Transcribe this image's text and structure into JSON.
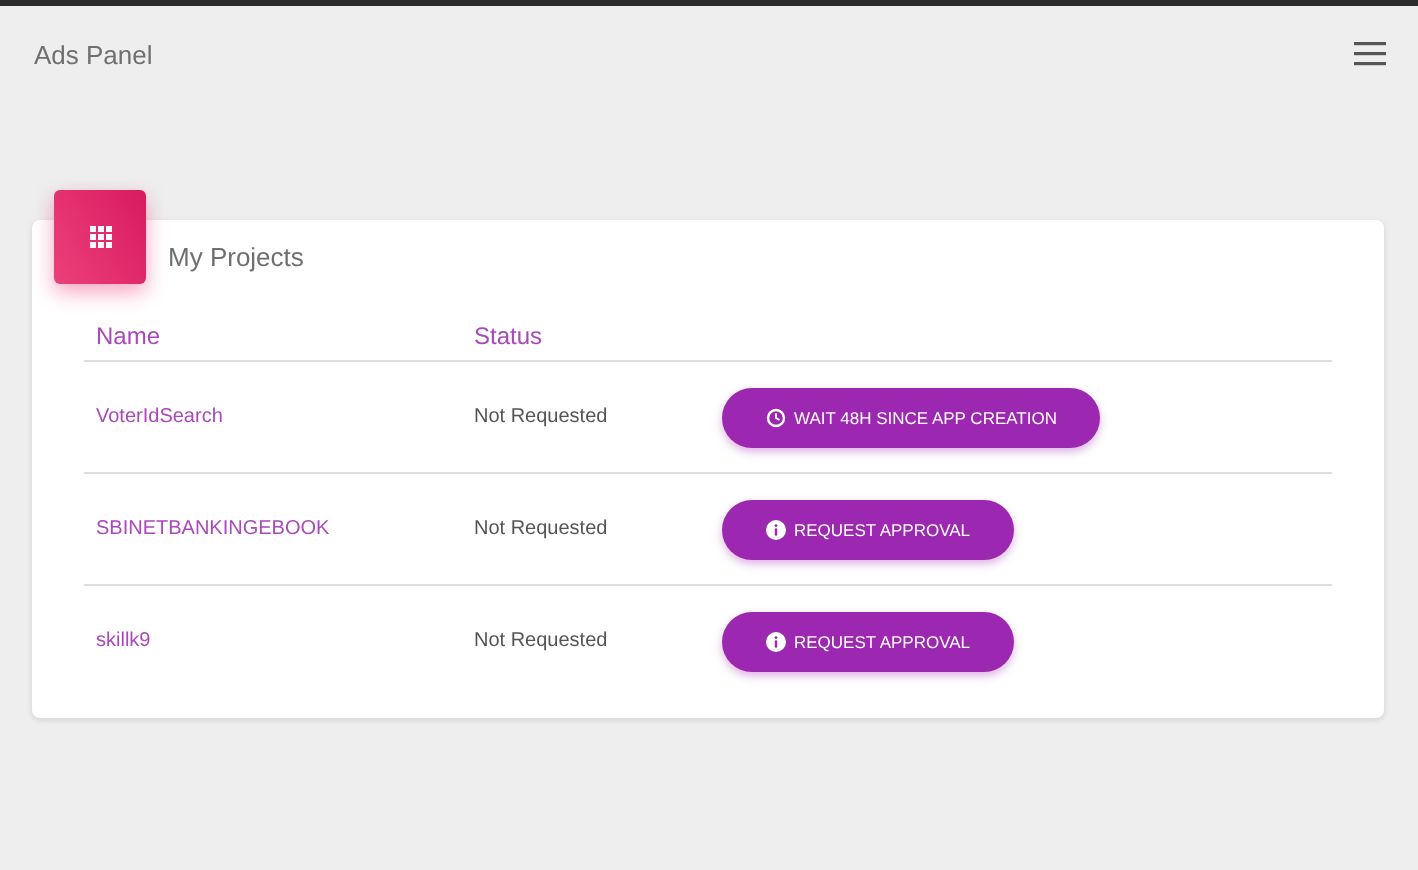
{
  "app_bar": {
    "title": "Ads Panel"
  },
  "card": {
    "title": "My Projects",
    "columns": [
      "Name",
      "Status"
    ],
    "rows": [
      {
        "name": "VoterIdSearch",
        "status": "Not Requested",
        "action": {
          "kind": "wait",
          "label": "WAIT 48H SINCE APP CREATION"
        }
      },
      {
        "name": "SBINETBANKINGEBOOK",
        "status": "Not Requested",
        "action": {
          "kind": "request",
          "label": "REQUEST APPROVAL"
        }
      },
      {
        "name": "skillk9",
        "status": "Not Requested",
        "action": {
          "kind": "request",
          "label": "REQUEST APPROVAL"
        }
      }
    ]
  }
}
